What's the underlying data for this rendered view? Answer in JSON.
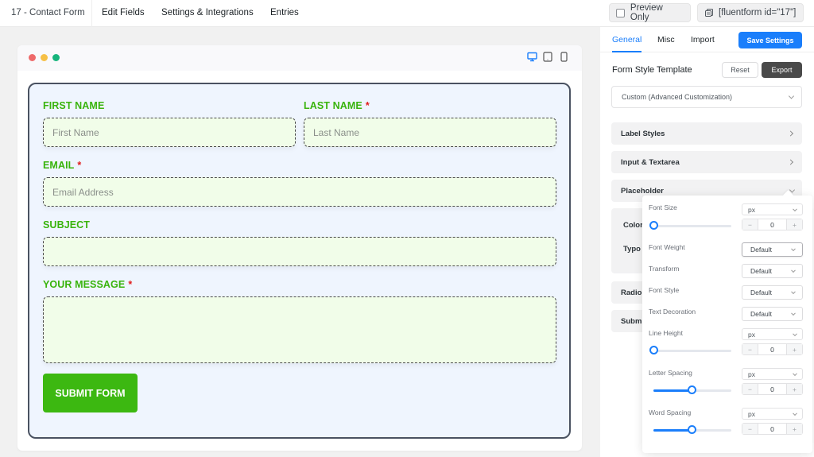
{
  "topbar": {
    "form_title": "17 - Contact Form",
    "nav": [
      "Edit Fields",
      "Settings & Integrations",
      "Entries"
    ],
    "preview_only_label": "Preview Only",
    "preview_only_checked": false,
    "shortcode_label": "[fluentform id=\"17\"]"
  },
  "preview": {
    "window_dots": [
      "#ee6a6a",
      "#f6c046",
      "#16b47c"
    ],
    "devices": [
      {
        "name": "desktop",
        "active": true
      },
      {
        "name": "tablet",
        "active": false
      },
      {
        "name": "mobile",
        "active": false
      }
    ]
  },
  "form": {
    "label_color": "#39b40c",
    "fields": {
      "first_name": {
        "label": "FIRST NAME",
        "required": false,
        "placeholder": "First Name"
      },
      "last_name": {
        "label": "LAST NAME",
        "required": true,
        "placeholder": "Last Name"
      },
      "email": {
        "label": "EMAIL",
        "required": true,
        "placeholder": "Email Address"
      },
      "subject": {
        "label": "SUBJECT",
        "required": false,
        "placeholder": ""
      },
      "message": {
        "label": "YOUR MESSAGE",
        "required": true,
        "placeholder": ""
      }
    },
    "required_mark": "*",
    "submit_label": "SUBMIT FORM",
    "submit_color": "#3cb811"
  },
  "panel": {
    "tabs": [
      "General",
      "Misc",
      "Import"
    ],
    "active_tab": "General",
    "save_label": "Save Settings",
    "accent_color": "#1a7efb",
    "template_label": "Form Style Template",
    "reset_label": "Reset",
    "export_label": "Export",
    "template_value": "Custom (Advanced Customization)",
    "sections": [
      "Label Styles",
      "Input & Textarea",
      "Placeholder",
      "Radio",
      "Subm"
    ],
    "placeholder_sub": [
      "Color",
      "Typo"
    ]
  },
  "typography": {
    "font_size": {
      "label": "Font Size",
      "unit": "px",
      "value": "0",
      "slider_percent": 0
    },
    "font_weight": {
      "label": "Font Weight",
      "value": "Default"
    },
    "transform": {
      "label": "Transform",
      "value": "Default"
    },
    "font_style": {
      "label": "Font Style",
      "value": "Default"
    },
    "text_decoration": {
      "label": "Text Decoration",
      "value": "Default"
    },
    "line_height": {
      "label": "Line Height",
      "unit": "px",
      "value": "0",
      "slider_percent": 0
    },
    "letter_spacing": {
      "label": "Letter Spacing",
      "unit": "px",
      "value": "0",
      "slider_percent": 50
    },
    "word_spacing": {
      "label": "Word Spacing",
      "unit": "px",
      "value": "0",
      "slider_percent": 50
    },
    "minus": "−",
    "plus": "+"
  }
}
